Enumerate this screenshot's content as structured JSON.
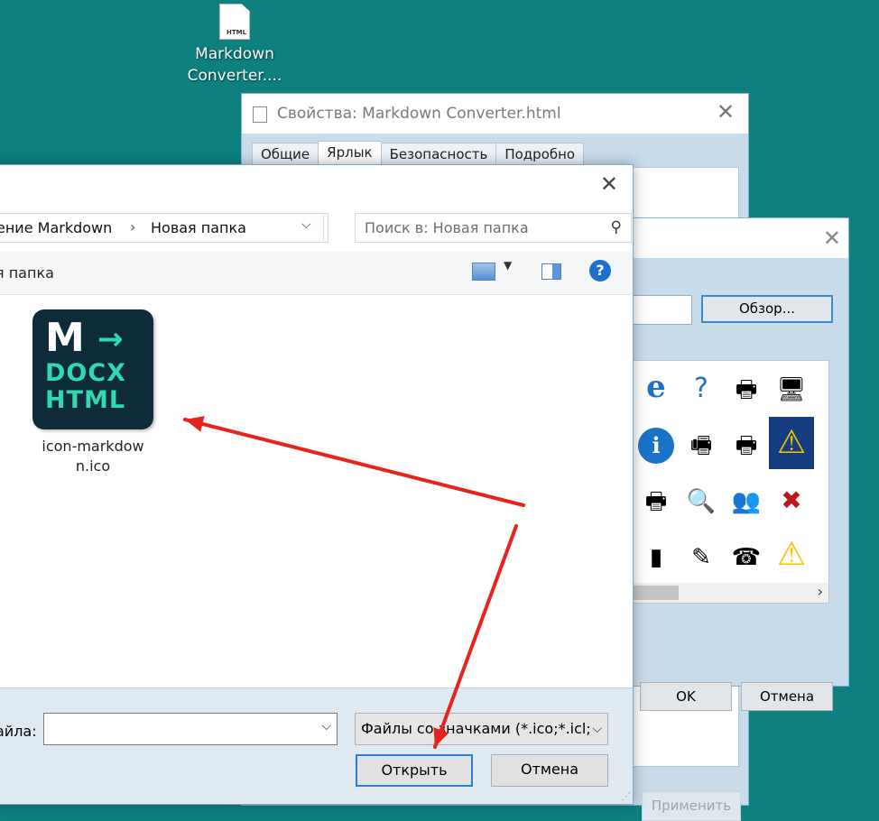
{
  "desktop": {
    "shortcut_label_line1": "Markdown",
    "shortcut_label_line2": "Converter....",
    "shortcut_icon_text": "HTML"
  },
  "properties_window": {
    "title": "Свойства: Markdown Converter.html",
    "tabs": [
      "Общие",
      "Ярлык",
      "Безопасность",
      "Подробно"
    ],
    "active_tab": "Ярлык",
    "apply_label": "Применить"
  },
  "change_icon_dialog": {
    "browse_label": "Обзор...",
    "ok_label": "OK",
    "cancel_label": "Отмена",
    "icons": [
      [
        "ie-icon",
        "question-file-icon",
        "network-printer-icon",
        "computer-icon"
      ],
      [
        "info-icon",
        "fax-printer-icon",
        "network-printer-icon",
        "warning-icon"
      ],
      [
        "printer-check-icon",
        "printer-search-icon",
        "users-printer-icon",
        "document-delete-icon"
      ],
      [
        "server-check-icon",
        "printer-edit-icon",
        "fax-machine-icon",
        "warning-icon"
      ]
    ]
  },
  "open_dialog": {
    "breadcrumb": [
      "ение Markdown",
      "Новая папка"
    ],
    "search_placeholder": "Поиск в: Новая папка",
    "folder_label": "я папка",
    "files": [
      {
        "name": "icon-markdown.ico",
        "thumb_line_m": "M",
        "thumb_arrow": "→",
        "thumb_line1": "DOCX",
        "thumb_line2": "HTML"
      }
    ],
    "filename_label": "айла:",
    "filename_value": "",
    "filter_value": "Файлы со значками (*.ico;*.icl;*",
    "open_label": "Открыть",
    "cancel_label": "Отмена",
    "help_label": "?"
  },
  "annotation_color": "#e8231f"
}
